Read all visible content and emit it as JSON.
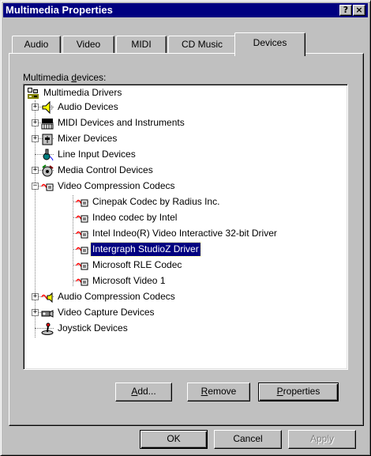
{
  "window": {
    "title": "Multimedia Properties",
    "help_button": "?",
    "close_button": "×"
  },
  "tabs": [
    {
      "label": "Audio",
      "active": false
    },
    {
      "label": "Video",
      "active": false
    },
    {
      "label": "MIDI",
      "active": false
    },
    {
      "label": "CD Music",
      "active": false
    },
    {
      "label": "Devices",
      "active": true
    }
  ],
  "devices_label": {
    "before": "Multimedia ",
    "mnemonic": "d",
    "after": "evices:"
  },
  "tree": {
    "root": "Multimedia Drivers",
    "items": [
      {
        "label": "Audio Devices",
        "icon": "speaker-icon",
        "expandable": true
      },
      {
        "label": "MIDI Devices and Instruments",
        "icon": "midi-keyboard-icon",
        "expandable": true
      },
      {
        "label": "Mixer Devices",
        "icon": "mixer-icon",
        "expandable": true
      },
      {
        "label": "Line Input Devices",
        "icon": "line-input-icon",
        "expandable": false
      },
      {
        "label": "Media Control Devices",
        "icon": "media-control-icon",
        "expandable": true
      },
      {
        "label": "Video Compression Codecs",
        "icon": "codec-icon",
        "expandable": true,
        "expanded": true,
        "children": [
          {
            "label": "Cinepak Codec by Radius Inc."
          },
          {
            "label": "Indeo codec by Intel"
          },
          {
            "label": "Intel Indeo(R) Video Interactive 32-bit Driver"
          },
          {
            "label": "Intergraph StudioZ Driver",
            "selected": true
          },
          {
            "label": "Microsoft RLE Codec"
          },
          {
            "label": "Microsoft Video 1"
          }
        ]
      },
      {
        "label": "Audio Compression Codecs",
        "icon": "audio-codec-icon",
        "expandable": true
      },
      {
        "label": "Video Capture Devices",
        "icon": "video-capture-icon",
        "expandable": true
      },
      {
        "label": "Joystick Devices",
        "icon": "joystick-icon",
        "expandable": false
      }
    ]
  },
  "buttons": {
    "add": {
      "mnemonic": "A",
      "rest": "dd..."
    },
    "remove": {
      "mnemonic": "R",
      "rest": "emove"
    },
    "properties": {
      "mnemonic": "P",
      "rest": "roperties"
    },
    "ok": "OK",
    "cancel": "Cancel",
    "apply": "Apply"
  },
  "colors": {
    "titlebar": "#000080",
    "face": "#c0c0c0",
    "selection": "#000080"
  }
}
